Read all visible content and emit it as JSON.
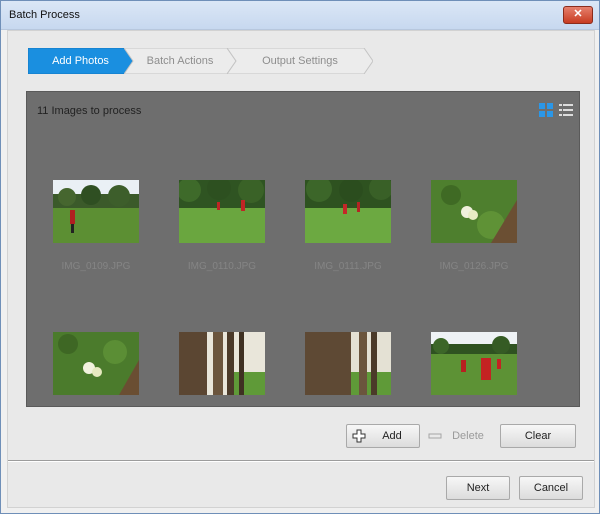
{
  "window": {
    "title": "Batch Process",
    "close_glyph": "✕"
  },
  "steps": [
    {
      "label": "Add Photos",
      "active": true
    },
    {
      "label": "Batch Actions",
      "active": false
    },
    {
      "label": "Output Settings",
      "active": false
    }
  ],
  "panel": {
    "title": "11 Images to process"
  },
  "view_icons": [
    "grid-view-icon",
    "list-view-icon"
  ],
  "thumbnails": [
    {
      "name": "IMG_0109.JPG"
    },
    {
      "name": "IMG_0110.JPG"
    },
    {
      "name": "IMG_0111.JPG"
    },
    {
      "name": "IMG_0126.JPG"
    },
    {
      "name": ""
    },
    {
      "name": ""
    },
    {
      "name": ""
    },
    {
      "name": ""
    }
  ],
  "actions": {
    "add_label": "Add",
    "delete_label": "Delete",
    "clear_label": "Clear"
  },
  "footer": {
    "next_label": "Next",
    "cancel_label": "Cancel"
  },
  "colors": {
    "accent": "#1a8fe0",
    "panel_bg": "#6e6e6e"
  }
}
